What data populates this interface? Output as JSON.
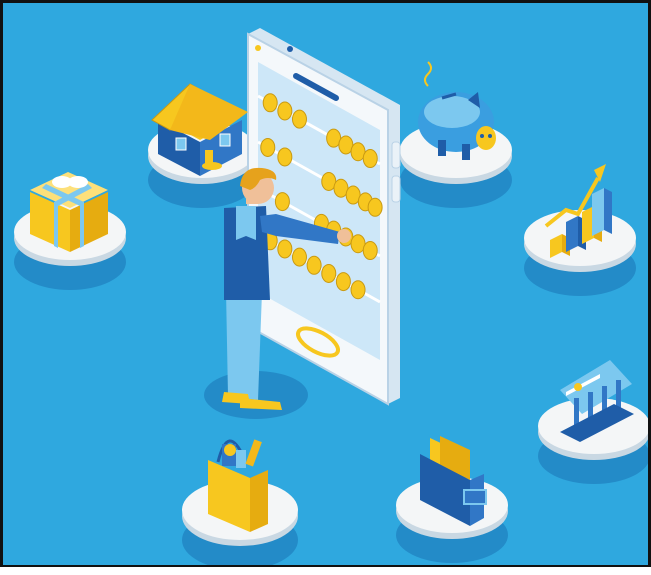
{
  "illustration": {
    "background_color": "#2fa8df",
    "frame_color": "#111111",
    "accent_yellow": "#f7c71f",
    "accent_blue_dark": "#1f5da8",
    "accent_blue_light": "#7cc8ef",
    "platform_white": "#f4f6f7",
    "elements": [
      "smartphone-abacus",
      "businessman",
      "house",
      "gift-box",
      "piggy-bank",
      "bar-chart-growth",
      "bank-building",
      "wallet",
      "shopping-bag"
    ]
  }
}
